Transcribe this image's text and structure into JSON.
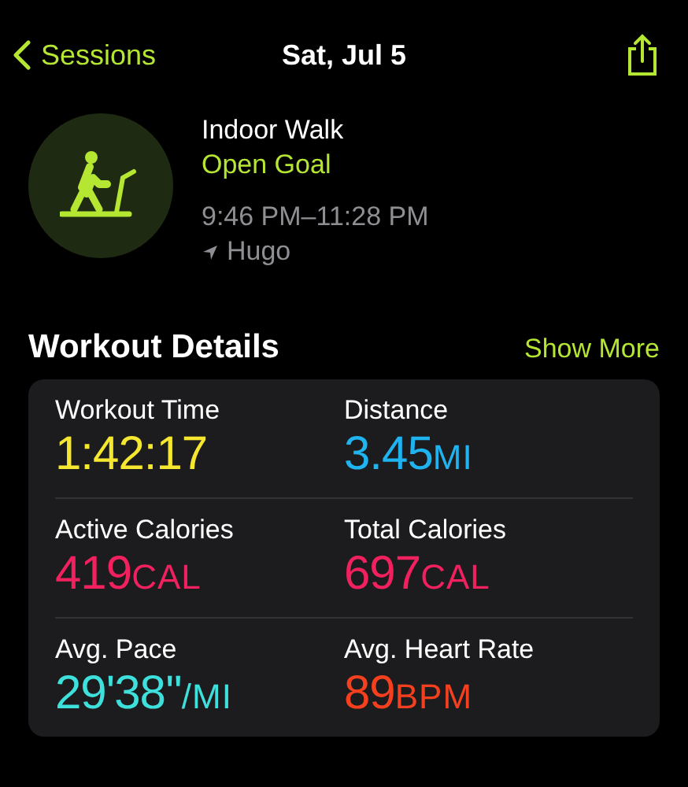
{
  "nav": {
    "back": "Sessions",
    "title": "Sat, Jul 5"
  },
  "workout": {
    "name": "Indoor Walk",
    "goal": "Open Goal",
    "time": "9:46 PM–11:28 PM",
    "location": "Hugo"
  },
  "details": {
    "title": "Workout Details",
    "action": "Show More",
    "metrics": [
      {
        "label": "Workout Time",
        "value": "1:42:17",
        "color": "#f5e62f"
      },
      {
        "label": "Distance",
        "value": "3.45",
        "unit": "MI",
        "color": "#1fb3f0"
      },
      {
        "label": "Active Calories",
        "value": "419",
        "unit": "CAL",
        "color": "#f0215e"
      },
      {
        "label": "Total Calories",
        "value": "697",
        "unit": "CAL",
        "color": "#f0215e"
      },
      {
        "label": "Avg. Pace",
        "value": "29'38''",
        "unit": "/MI",
        "color": "#3ee0dc"
      },
      {
        "label": "Avg. Heart Rate",
        "value": "89",
        "unit": "BPM",
        "color": "#f5401f"
      }
    ]
  }
}
